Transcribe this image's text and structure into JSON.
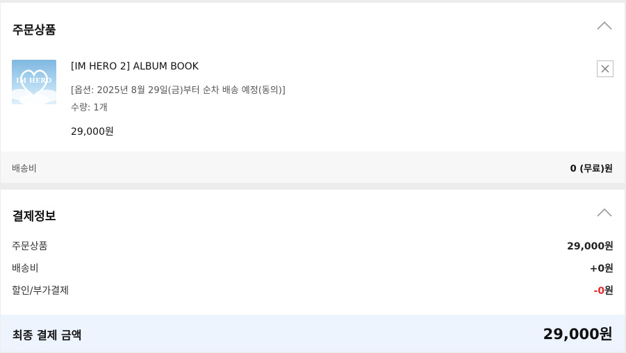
{
  "order": {
    "title": "주문상품",
    "product": {
      "name": "[IM HERO 2] ALBUM BOOK",
      "option": "[옵션: 2025년 8월 29일(금)부터 순차 배송 예정(동의)]",
      "quantity": "수량: 1개",
      "price": "29,000원",
      "thumb_title": "IM HERO"
    },
    "shipping": {
      "label": "배송비",
      "value": "0 (무료)원"
    }
  },
  "payment": {
    "title": "결제정보",
    "rows": [
      {
        "label": "주문상품",
        "value": "29,000원"
      },
      {
        "label": "배송비",
        "value": "+0원"
      },
      {
        "label": "할인/부가결제",
        "value_red": "-0",
        "value_unit": "원"
      }
    ],
    "total": {
      "label": "최종 결제 금액",
      "value": "29,000원"
    }
  },
  "colors": {
    "discount": "#e52b2b",
    "total_bg": "#eef4fd",
    "page_bg": "#ececec"
  }
}
